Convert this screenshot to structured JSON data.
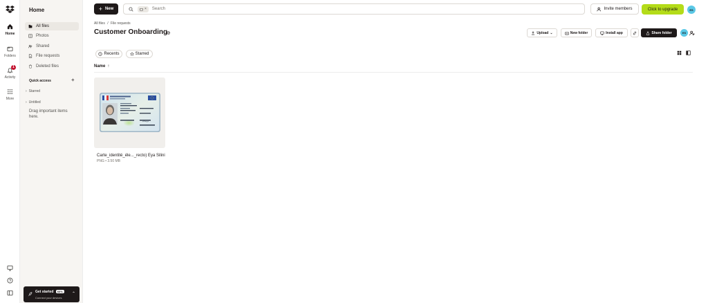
{
  "sidebar": {
    "title": "Home",
    "items": [
      {
        "label": "All files"
      },
      {
        "label": "Photos"
      },
      {
        "label": "Shared"
      },
      {
        "label": "File requests"
      },
      {
        "label": "Deleted files"
      }
    ],
    "quick_access": "Quick access",
    "groups": [
      {
        "label": "Starred"
      },
      {
        "label": "Untitled"
      }
    ],
    "hint": "Drag important items here.",
    "get_started": {
      "title": "Get started",
      "percent": "66%",
      "subtitle": "Connect your devices"
    }
  },
  "rail": {
    "items": [
      {
        "label": "Home"
      },
      {
        "label": "Folders"
      },
      {
        "label": "Activity",
        "badge": "1"
      },
      {
        "label": "More"
      }
    ]
  },
  "topbar": {
    "new_label": "New",
    "search_placeholder": "Search",
    "invite_label": "Invite members",
    "upgrade_label": "Click to upgrade",
    "avatar_initials": "ES"
  },
  "header": {
    "breadcrumbs": [
      "All files",
      "/",
      "File requests"
    ],
    "title": "Customer Onboarding",
    "upload_label": "Upload",
    "new_folder_label": "New folder",
    "install_app_label": "Install app",
    "share_folder_label": "Share folder"
  },
  "filters": {
    "recents": "Recents",
    "starred": "Starred"
  },
  "list": {
    "name_header": "Name",
    "sort_arrow": "↑"
  },
  "files": [
    {
      "name": "Carte_identité_éle..._recto) Eya Silini",
      "meta": "PNG • 3.50 MB"
    }
  ],
  "colors": {
    "accent": "#b4dc19",
    "dark": "#1e1919",
    "avatar": "#5ac8e6",
    "badge": "#c4122f"
  }
}
